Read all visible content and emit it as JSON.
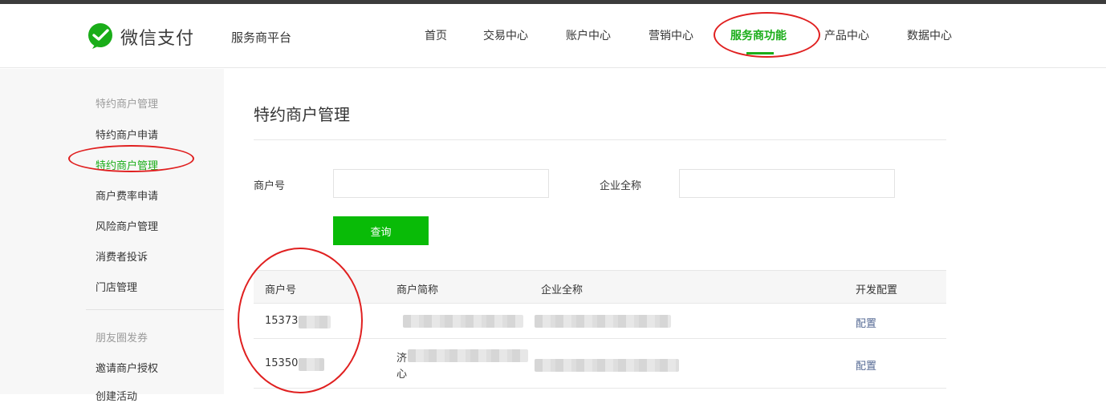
{
  "header": {
    "logo_text": "微信支付",
    "platform": "服务商平台",
    "nav": [
      "首页",
      "交易中心",
      "账户中心",
      "营销中心",
      "服务商功能",
      "产品中心",
      "数据中心"
    ],
    "active_nav": "服务商功能"
  },
  "sidebar": {
    "group1_title": "特约商户管理",
    "group1_items": [
      "特约商户申请",
      "特约商户管理",
      "商户费率申请",
      "风险商户管理",
      "消费者投诉",
      "门店管理"
    ],
    "active_item": "特约商户管理",
    "group2_title": "朋友圈发券",
    "group2_items": [
      "邀请商户授权",
      "创建活动"
    ]
  },
  "main": {
    "title": "特约商户管理",
    "filters": {
      "merchant_id_label": "商户号",
      "merchant_id_value": "",
      "company_name_label": "企业全称",
      "company_name_value": ""
    },
    "query_button": "查询",
    "table": {
      "headers": [
        "商户号",
        "商户简称",
        "企业全称",
        "开发配置"
      ],
      "rows": [
        {
          "merchant_id": "15373",
          "short_name": "",
          "full_name": "",
          "action": "配置"
        },
        {
          "merchant_id": "15350",
          "short_name_line1": "济",
          "short_name_line2": "心",
          "full_name": "",
          "action": "配置"
        }
      ]
    }
  },
  "colors": {
    "accent": "#1aad19",
    "button": "#09bb07",
    "link": "#576b95",
    "annotation": "#e02020"
  }
}
